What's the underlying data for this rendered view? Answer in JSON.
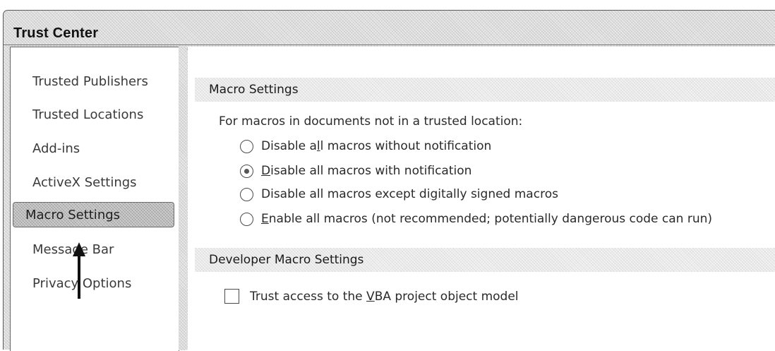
{
  "window": {
    "title": "Trust Center"
  },
  "sidebar": {
    "items": [
      {
        "label": "Trusted Publishers",
        "selected": false
      },
      {
        "label": "Trusted Locations",
        "selected": false
      },
      {
        "label": "Add-ins",
        "selected": false
      },
      {
        "label": "ActiveX Settings",
        "selected": false
      },
      {
        "label": "Macro Settings",
        "selected": true
      },
      {
        "label": "Message Bar",
        "selected": false
      },
      {
        "label": "Privacy Options",
        "selected": false
      }
    ]
  },
  "macro_settings": {
    "header": "Macro Settings",
    "intro": "For macros in documents not in a trusted location:",
    "options": [
      {
        "pre": "Disable a",
        "key": "l",
        "post": "l macros without notification",
        "checked": false
      },
      {
        "pre": "",
        "key": "D",
        "post": "isable all macros with notification",
        "checked": true
      },
      {
        "pre": "Disable all macros except di",
        "key": "g",
        "post": "itally signed macros",
        "checked": false
      },
      {
        "pre": "",
        "key": "E",
        "post": "nable all macros (not recommended; potentially dangerous code can run)",
        "checked": false
      }
    ]
  },
  "developer_macro_settings": {
    "header": "Developer Macro Settings",
    "trust_vba": {
      "pre": "Trust access to the ",
      "key": "V",
      "post": "BA project object model",
      "checked": false
    }
  }
}
